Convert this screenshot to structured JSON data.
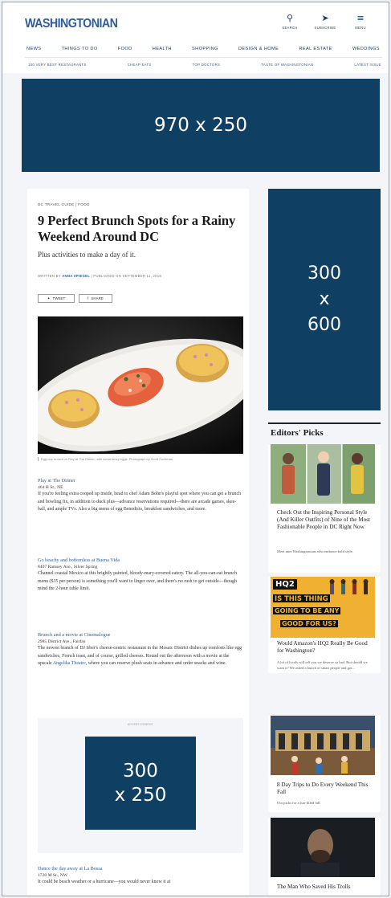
{
  "header": {
    "logo": "WASHINGTONIAN",
    "icons": [
      {
        "icon": "search-icon",
        "glyph": "⚲",
        "label": "SEARCH"
      },
      {
        "icon": "subscribe-icon",
        "glyph": "➤",
        "label": "SUBSCRIBE"
      },
      {
        "icon": "menu-icon",
        "glyph": "≡",
        "label": "MENU"
      }
    ],
    "nav_primary": [
      "NEWS",
      "THINGS TO DO",
      "FOOD",
      "HEALTH",
      "SHOPPING",
      "DESIGN & HOME",
      "REAL ESTATE",
      "WEDDINGS"
    ],
    "nav_secondary": [
      "100 VERY BEST RESTAURANTS",
      "CHEAP EATS",
      "TOP DOCTORS",
      "TASTE OF WASHINGTONIAN",
      "LATEST ISSUE"
    ]
  },
  "ads": {
    "top": "970 x 250",
    "side_line1": "300",
    "side_line2": "x",
    "side_line3": "600",
    "inline_line1": "300",
    "inline_line2": "x 250",
    "inline_label": "ADVERTISEMENT"
  },
  "article": {
    "kicker": "DC TRAVEL GUIDE  |  FOOD",
    "title": "9 Perfect Brunch Spots for a Rainy Weekend Around DC",
    "dek": "Plus activities to make a day of it.",
    "byline_prefix": "WRITTEN BY",
    "author": "ANNA SPIEGEL",
    "byline_suffix": "| PUBLISHED ON SEPTEMBER 11, 2018",
    "tweet_label": "TWEET",
    "share_label": "SHARE",
    "caption": "Egg-cup brunch at Play at The Dinner; with some fancy eggs. Photograph by Scott Suchman.",
    "entries": [
      {
        "heading": "Play at The Dinner",
        "address": "464 H St., NE",
        "body": "If you're feeling extra cooped up inside, head to chef Adam Bohn's playful spot where you can get a brunch and bowling fix, in addition to duck plus—advance reservations required—there are arcade games, skee-ball, and ample TVs. Also a big menu of egg Benedicts, breakfast sandwiches, and more."
      },
      {
        "heading": "Go beachy and bottomless at Buena Vida",
        "address": "8407 Ramsey Ave., Silver Spring",
        "body": "Channel coastal Mexico at this brightly painted, bloody-mary-covered eatery. The all-you-can-eat brunch menu ($35 per person) is something you'll want to linger over, and there's no rush to get outside—though mind the 2-hour table limit."
      },
      {
        "heading": "Brunch and a movie at Cinemalogue",
        "address": "2985 District Ave., Fairfax",
        "body_before": "The newest branch of DJ Irber's cheese-centric restaurant in the Mosaic District dishes up comforts like egg sandwiches, French toast, and of course, grilled cheeses. Round out the afternoon with a movie at the upscale ",
        "body_link": "Angelika Theatre",
        "body_after": ", where you can reserve plush seats in advance and order snacks and wine."
      },
      {
        "heading": "Dance the day away at La Bossa",
        "address": "1720 M St., NW",
        "body": "It could be beach weather or a hurricane—you would never know it at"
      }
    ]
  },
  "editors_picks": {
    "heading": "Editors' Picks",
    "items": [
      {
        "title": "Check Out the Inspiring Personal Style (And Killer Outfits) of Nine of the Most Fashionable People in DC Right Now",
        "dek": "Meet nine Washingtonians who embrace bold style."
      },
      {
        "image_text_1": "HQ2",
        "image_text_2": "IS THIS THING",
        "image_text_3": "GOING TO BE ANY",
        "image_text_4": "GOOD FOR US?",
        "title": "Would Amazon's HQ2 Really Be Good for Washington?",
        "dek": "A lot of locals will tell you we deserve so bad. But should we want it? We asked a bunch of smart people and got..."
      },
      {
        "title": "8 Day Trips to Do Every Weekend This Fall",
        "dek": "Our picks for a fun-filled fall."
      },
      {
        "title": "The Man Who Saved His Trolls",
        "dek": ""
      }
    ]
  }
}
